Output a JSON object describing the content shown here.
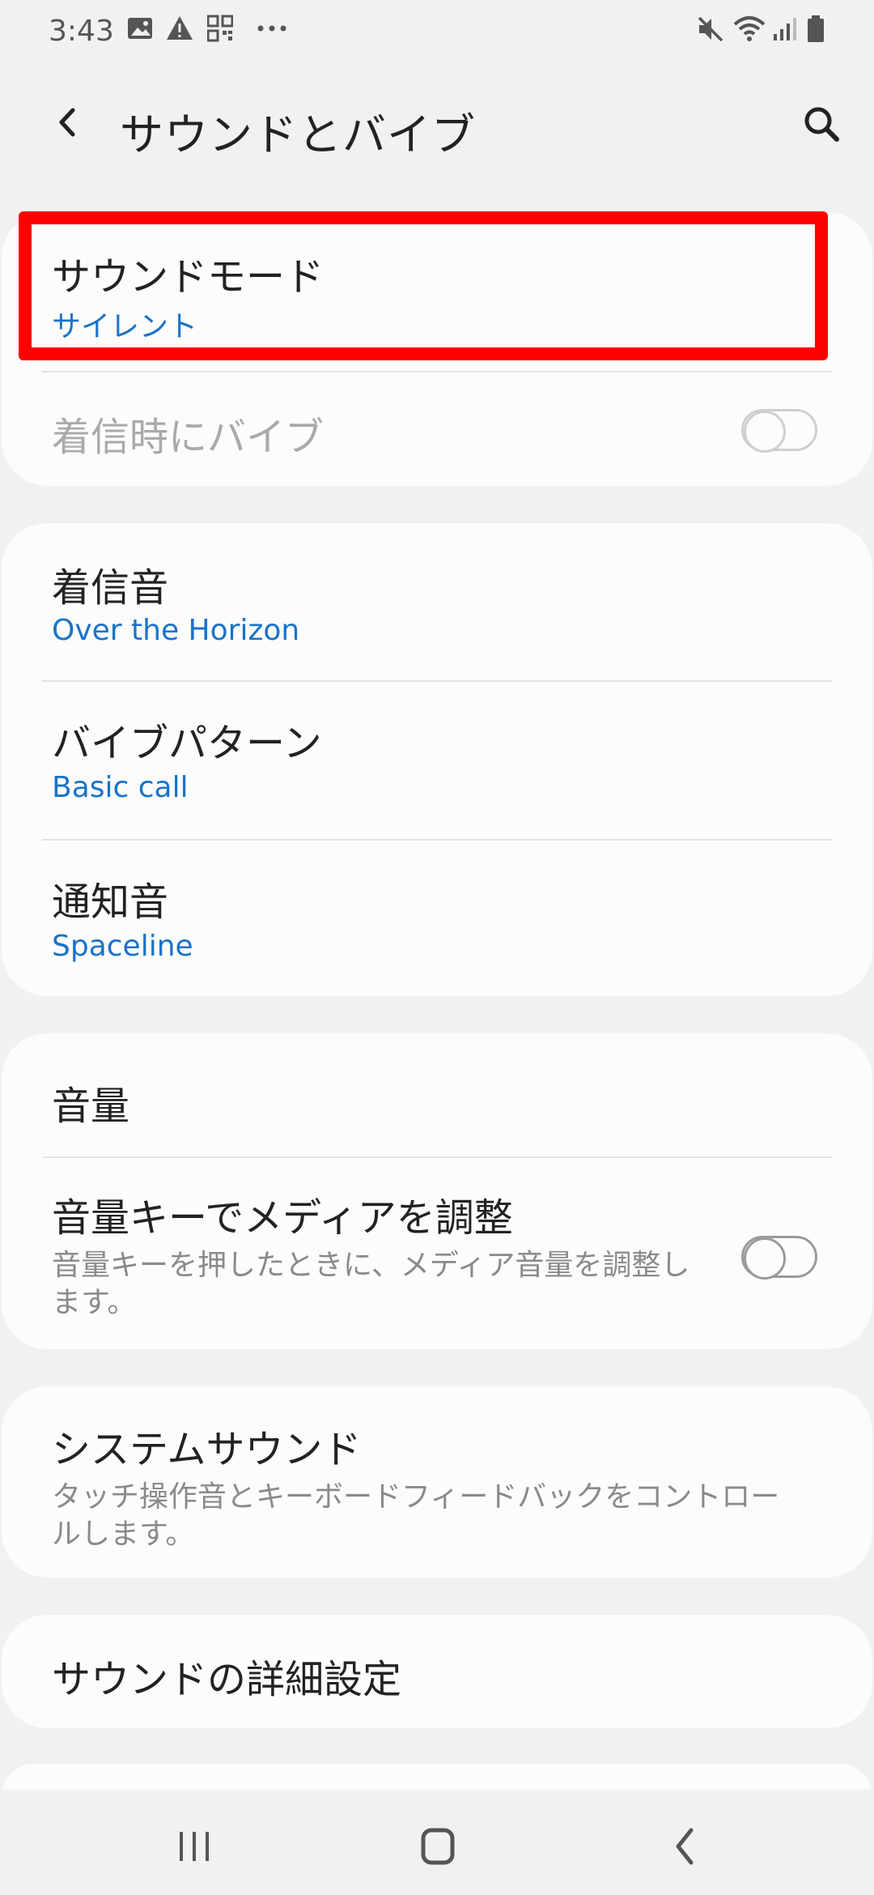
{
  "status_bar": {
    "time": "3:43",
    "left_icons": [
      "image-icon",
      "warning-icon",
      "qr-code-icon",
      "more-dots-icon"
    ],
    "right_icons": [
      "mute-icon",
      "wifi-icon",
      "signal-icon",
      "battery-icon"
    ]
  },
  "header": {
    "title": "サウンドとバイブ",
    "back_icon": "back-arrow-icon",
    "search_icon": "search-icon"
  },
  "cards": [
    {
      "items": [
        {
          "title": "サウンドモード",
          "subtitle": "サイレント",
          "highlighted": true
        },
        {
          "title": "着信時にバイブ",
          "toggle": false,
          "disabled": true
        }
      ]
    },
    {
      "items": [
        {
          "title": "着信音",
          "subtitle": "Over the Horizon"
        },
        {
          "title": "バイブパターン",
          "subtitle": "Basic call"
        },
        {
          "title": "通知音",
          "subtitle": "Spaceline"
        }
      ]
    },
    {
      "items": [
        {
          "title": "音量"
        },
        {
          "title": "音量キーでメディアを調整",
          "description": "音量キーを押したときに、メディア音量を調整します。",
          "toggle": false
        }
      ]
    },
    {
      "items": [
        {
          "title": "システムサウンド",
          "description": "タッチ操作音とキーボードフィードバックをコントロールします。"
        }
      ]
    },
    {
      "items": [
        {
          "title": "サウンドの詳細設定"
        }
      ]
    }
  ],
  "nav_bar": {
    "icons": [
      "recent-apps-icon",
      "home-icon",
      "back-icon"
    ]
  },
  "colors": {
    "background": "#f1f1f1",
    "card": "#fcfcfc",
    "accent_blue": "#1a73c8",
    "highlight_red": "#ff0000"
  }
}
